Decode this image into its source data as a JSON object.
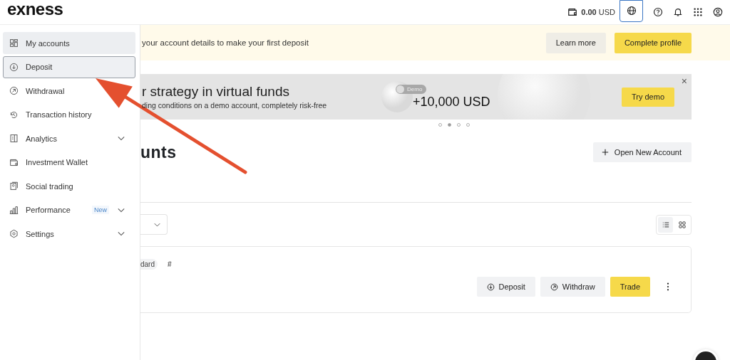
{
  "header": {
    "logo": "exness",
    "balance": "**0.00** USD",
    "language_button": {
      "selected": true
    }
  },
  "sidebar": {
    "items": [
      {
        "label": "My accounts",
        "selected": false,
        "hovered": true,
        "expandable": false
      },
      {
        "label": "Deposit",
        "selected": true,
        "hovered": false,
        "expandable": false
      },
      {
        "label": "Withdrawal",
        "selected": false,
        "hovered": false,
        "expandable": false
      },
      {
        "label": "Transaction history",
        "selected": false,
        "hovered": false,
        "expandable": false
      },
      {
        "label": "Analytics",
        "selected": false,
        "hovered": false,
        "expandable": true
      },
      {
        "label": "Investment Wallet",
        "selected": false,
        "hovered": false,
        "expandable": false
      },
      {
        "label": "Social trading",
        "selected": false,
        "hovered": false,
        "expandable": false
      },
      {
        "label": "Performance",
        "selected": false,
        "hovered": false,
        "expandable": true,
        "badge": "New"
      },
      {
        "label": "Settings",
        "selected": false,
        "hovered": false,
        "expandable": true
      }
    ]
  },
  "notice": {
    "text": "your account details to make your first deposit",
    "buttons": [
      {
        "label": "Learn more",
        "kind": "secondary"
      },
      {
        "label": "Complete profile",
        "kind": "primary"
      }
    ]
  },
  "promo": {
    "title": "r strategy in virtual funds",
    "subtitle": "ding conditions on a demo account, completely risk-free",
    "toggle_label": "Demo",
    "amount": "+10,000 USD",
    "button": "Try demo",
    "close": "×",
    "slides": [
      {
        "selected": false
      },
      {
        "selected": true
      },
      {
        "selected": false
      },
      {
        "selected": false
      }
    ]
  },
  "accounts": {
    "heading": "unts",
    "new_account_button": "Open New Account",
    "views": [
      {
        "kind": "list",
        "selected": true
      },
      {
        "kind": "grid",
        "selected": false
      }
    ],
    "card": {
      "tag": "dard",
      "number": "#",
      "buttons": [
        {
          "label": "Deposit",
          "kind": "deposit"
        },
        {
          "label": "Withdraw",
          "kind": "withdraw"
        },
        {
          "label": "Trade",
          "kind": "primary"
        }
      ]
    }
  }
}
